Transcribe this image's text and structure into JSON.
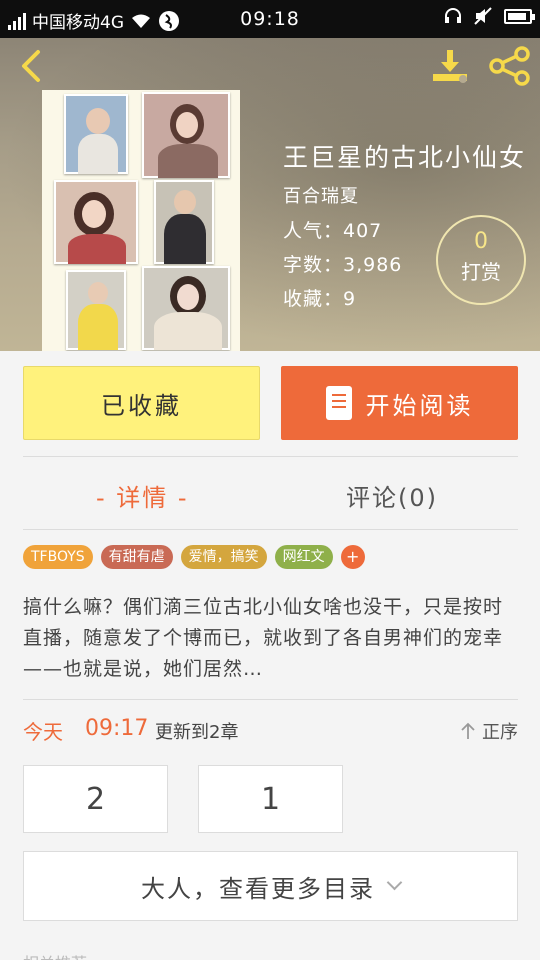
{
  "status_bar": {
    "carrier": "中国移动4G",
    "time": "09:18"
  },
  "header": {
    "back_icon": "back-arrow-icon",
    "download_icon": "download-icon",
    "share_icon": "share-icon"
  },
  "book": {
    "title": "王巨星的古北小仙女",
    "author": "百合瑞夏",
    "popularity": "人气：407",
    "word_count": "字数：3,986",
    "favorites": "收藏：9",
    "reward_count": "0",
    "reward_label": "打赏"
  },
  "actions": {
    "collected_label": "已收藏",
    "read_label": "开始阅读",
    "read_icon": "book-icon"
  },
  "tabs": [
    {
      "label": "- 详情 -",
      "active": true
    },
    {
      "label": "评论(0)",
      "active": false
    }
  ],
  "tags": [
    {
      "label": "TFBOYS",
      "color": "#f0a33a"
    },
    {
      "label": "有甜有虐",
      "color": "#c96a55"
    },
    {
      "label": "爱情，搞笑",
      "color": "#d4a63e"
    },
    {
      "label": "网红文",
      "color": "#8fb04a"
    }
  ],
  "tag_add_label": "+",
  "summary": "搞什么嘛？偶们滴三位古北小仙女啥也没干，只是按时直播，随意发了个博而已，就收到了各自男神们的宠幸——也就是说，她们居然…",
  "update": {
    "day": "今天",
    "time": "09:17",
    "text": "更新到2章",
    "sort_label": "正序"
  },
  "chapters": [
    "2",
    "1"
  ],
  "catalog_label": "大人，查看更多目录",
  "bottom_peek": "相关推荐"
}
